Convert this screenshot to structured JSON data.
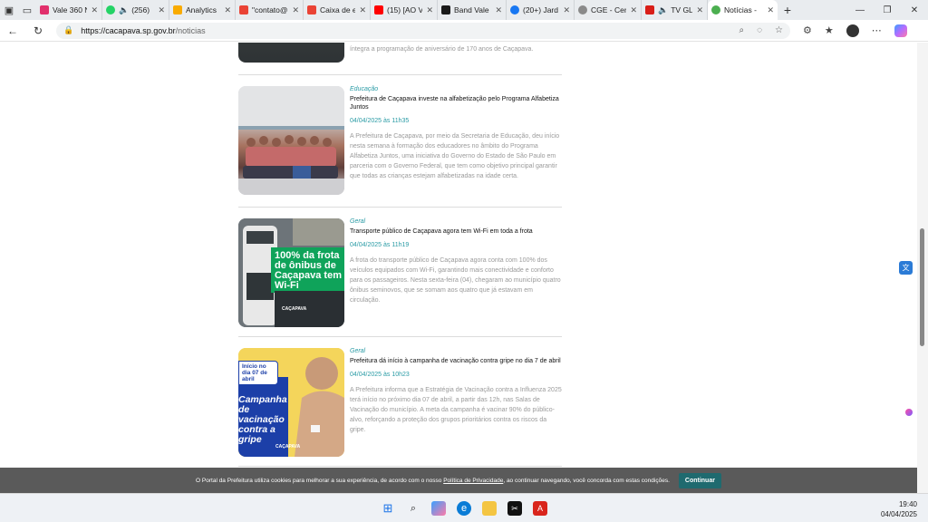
{
  "browser": {
    "tabs": [
      {
        "label": "Vale 360 N",
        "color": "#e1306c"
      },
      {
        "label": "(256)",
        "color": "#25d366"
      },
      {
        "label": "Analytics",
        "color": "#f9ab00"
      },
      {
        "label": "\"contato@",
        "color": "#ea4335"
      },
      {
        "label": "Caixa de e",
        "color": "#ea4335"
      },
      {
        "label": "(15) [AO V",
        "color": "#ff0000"
      },
      {
        "label": "Band Vale",
        "color": "#1a1a1a"
      },
      {
        "label": "(20+) Jard",
        "color": "#1877f2"
      },
      {
        "label": "CGE - Cen",
        "color": "#8a8a8a"
      },
      {
        "label": "TV GL",
        "color": "#d91e18"
      },
      {
        "label": "Notícias -",
        "color": "#4caf50",
        "active": true
      }
    ],
    "url_host": "https://cacapava.sp.gov.br",
    "url_path": "/noticias"
  },
  "articles": [
    {
      "summary_tail": "íntegra a programação de aniversário de 170 anos de Caçapava."
    },
    {
      "category": "Educação",
      "title": "Prefeitura de Caçapava investe na alfabetização pelo Programa Alfabetiza Juntos",
      "date": "04/04/2025 às 11h35",
      "summary": "A Prefeitura de Caçapava, por meio da Secretaria de Educação, deu início nesta semana à formação dos educadores no âmbito do Programa Alfabetiza Juntos, uma iniciativa do Governo do Estado de São Paulo em parceria com o Governo Federal, que tem como objetivo principal garantir que todas as crianças estejam alfabetizadas na idade certa."
    },
    {
      "category": "Geral",
      "title": "Transporte público de Caçapava agora tem Wi-Fi em toda a frota",
      "date": "04/04/2025 às 11h19",
      "summary": "A frota do transporte público de Caçapava agora conta com 100% dos veículos equipados com Wi-Fi, garantindo mais conectividade e conforto para os passageiros. Nesta sexta-feira (04), chegaram ao município quatro ônibus seminovos, que se somam aos quatro que já estavam em circulação.",
      "image_text": "100% da frota de ônibus de Caçapava tem Wi-Fi",
      "image_brand": "CAÇAPAVA"
    },
    {
      "category": "Geral",
      "title": "Prefeitura dá início à campanha de vacinação contra gripe no dia 7 de abril",
      "date": "04/04/2025 às 10h23",
      "summary": "A Prefeitura informa que a Estratégia de Vacinação contra a Influenza 2025 terá início no próximo dia 07 de abril, a partir das 12h, nas Salas de Vacinação do município. A meta da campanha é vacinar 90% do público-alvo, reforçando a proteção dos grupos prioritários contra os riscos da gripe.",
      "image_badge": "Início no dia 07 de abril",
      "image_text": "Campanha de vacinação contra a gripe",
      "image_brand": "CAÇAPAVA"
    }
  ],
  "cookie": {
    "text_before": "O Portal da Prefeitura utiliza cookies para melhorar a sua experiência, de acordo com o nosso",
    "link": "Política de Privacidade",
    "text_after": ", ao continuar navegando, você concorda com estas condições.",
    "button": "Continuar"
  },
  "taskbar": {
    "time": "19:40",
    "date": "04/04/2025"
  }
}
